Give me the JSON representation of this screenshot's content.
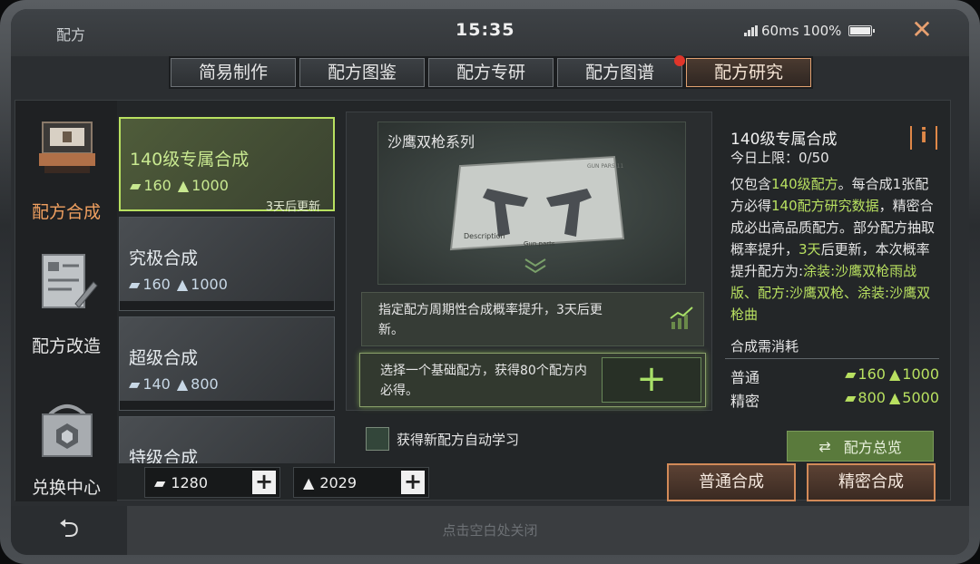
{
  "window": {
    "title": "配方",
    "time": "15:35",
    "ping": "60ms",
    "battery": "100%"
  },
  "tabs": [
    {
      "label": "简易制作",
      "active": false
    },
    {
      "label": "配方图鉴",
      "active": false
    },
    {
      "label": "配方专研",
      "active": false
    },
    {
      "label": "配方图谱",
      "active": false,
      "badge": true
    },
    {
      "label": "配方研究",
      "active": true
    }
  ],
  "sidebar": [
    {
      "label": "配方合成",
      "icon": "crafting-machine-icon",
      "active": true
    },
    {
      "label": "配方改造",
      "icon": "blueprint-pen-icon",
      "active": false
    },
    {
      "label": "兑换中心",
      "icon": "shopping-bag-icon",
      "active": false
    }
  ],
  "recipes": [
    {
      "name": "140级专属合成",
      "cost_a": "160",
      "cost_b": "1000",
      "note": "3天后更新",
      "selected": true
    },
    {
      "name": "究极合成",
      "cost_a": "160",
      "cost_b": "1000",
      "note": "",
      "selected": false
    },
    {
      "name": "超级合成",
      "cost_a": "140",
      "cost_b": "800",
      "note": "",
      "selected": false
    },
    {
      "name": "特级合成",
      "cost_a": "",
      "cost_b": "",
      "note": "",
      "selected": false
    }
  ],
  "center": {
    "series_title": "沙鹰双枪系列",
    "image_texts": [
      "GUN PARS 11",
      "Description",
      "Gun parts"
    ],
    "prob_text": "指定配方周期性合成概率提升，3天后更新。",
    "pick_text": "选择一个基础配方，获得80个配方内必得。",
    "add_symbol": "+",
    "auto_learn": "获得新配方自动学习"
  },
  "detail": {
    "title": "140级专属合成",
    "limit": "今日上限：0/50",
    "info_symbol": "i",
    "desc_parts": [
      {
        "t": "仅包含",
        "hl": false
      },
      {
        "t": "140级配方",
        "hl": true
      },
      {
        "t": "。每合成1张配方必得",
        "hl": false
      },
      {
        "t": "140配方研究数据",
        "hl": true
      },
      {
        "t": "，精密合成必出高品质配方。部分配方抽取概率提升，",
        "hl": false
      },
      {
        "t": "3天",
        "hl": true
      },
      {
        "t": "后更新，本次概率提升配方为:",
        "hl": false
      },
      {
        "t": "涂装:沙鹰双枪雨战版、配方:沙鹰双枪、涂装:沙鹰双枪曲",
        "hl": true
      }
    ],
    "consume_label": "合成需消耗",
    "rows": [
      {
        "label": "普通",
        "a": "160",
        "b": "1000"
      },
      {
        "label": "精密",
        "a": "800",
        "b": "5000"
      }
    ]
  },
  "overview_button": "配方总览",
  "resources": [
    {
      "value": "1280",
      "icon": "research-data-icon"
    },
    {
      "value": "2029",
      "icon": "gold-bars-icon"
    }
  ],
  "buttons": {
    "normal": "普通合成",
    "precise": "精密合成"
  },
  "footer": {
    "hint": "点击空白处关闭",
    "back_symbol": "⮌"
  },
  "colors": {
    "accent_green": "#b8e060",
    "accent_orange": "#e08848",
    "badge_red": "#e0352a"
  }
}
